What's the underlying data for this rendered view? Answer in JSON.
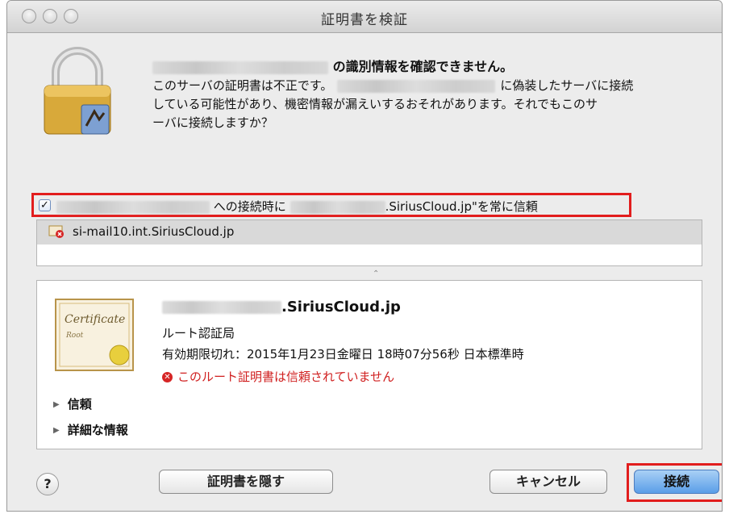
{
  "window": {
    "title": "証明書を検証"
  },
  "dialog": {
    "headline": "の識別情報を確認できません。",
    "body_lines": [
      "このサーバの証明書は不正です。",
      "に偽装したサーバに接続",
      "している可能性があり、機密情報が漏えいするおそれがあります。それでもこのサ",
      "ーバに接続しますか？"
    ]
  },
  "trust_checkbox": {
    "checked": true,
    "text_part1": "への接続時に",
    "text_part2": ".SiriusCloud.jp\"を常に信頼"
  },
  "cert_list": {
    "items": [
      {
        "label": "si-mail10.int.SiriusCloud.jp"
      }
    ]
  },
  "detail": {
    "name_suffix": ".SiriusCloud.jp",
    "subtitle": "ルート認証局",
    "expiry": "有効期限切れ：2015年1月23日金曜日 18時07分56秒 日本標準時",
    "error": "このルート証明書は信頼されていません",
    "sections": [
      {
        "label": "信頼"
      },
      {
        "label": "詳細な情報"
      }
    ]
  },
  "buttons": {
    "help": "?",
    "hide": "証明書を隠す",
    "cancel": "キャンセル",
    "connect": "接続"
  },
  "colors": {
    "highlight_border": "#e21d1d",
    "error_text": "#d02020",
    "default_button": "#5a9ee8"
  }
}
